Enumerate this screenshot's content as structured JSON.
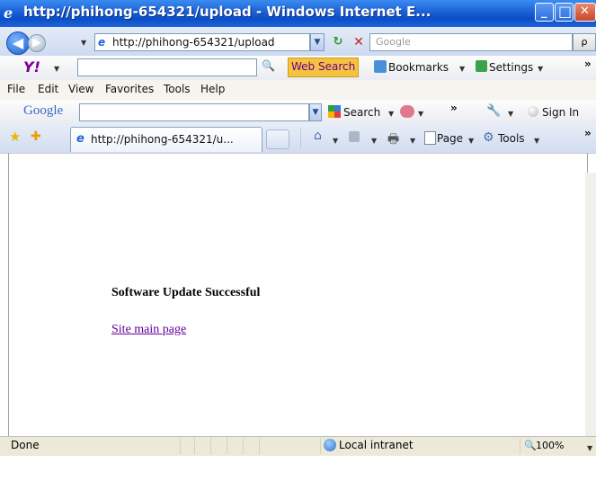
{
  "window": {
    "title": "http://phihong-654321/upload - Windows Internet E...",
    "min_glyph": "_",
    "max_glyph": "□",
    "close_glyph": "✕"
  },
  "nav": {
    "back_glyph": "◀",
    "forward_glyph": "▶",
    "address": "http://phihong-654321/upload",
    "search_placeholder": "Google",
    "search_glyph": "ρ"
  },
  "yahoo_toolbar": {
    "logo": "Y!",
    "web_search": "Web Search",
    "bookmarks": "Bookmarks",
    "settings": "Settings",
    "more": "»"
  },
  "menu": [
    "File",
    "Edit",
    "View",
    "Favorites",
    "Tools",
    "Help"
  ],
  "google_toolbar": {
    "logo": "Google",
    "search": "Search",
    "more": "»",
    "sign_in": "Sign In"
  },
  "tabs": {
    "active_tab": "http://phihong-654321/u...",
    "page_menu": "Page",
    "tools_menu": "Tools"
  },
  "content": {
    "heading": "Software Update Successful",
    "link": "Site main page"
  },
  "status": {
    "text": "Done",
    "zone": "Local intranet",
    "zoom": "100%"
  },
  "colors": {
    "titlebar": "#1b5fd6",
    "link_visited": "#660099"
  }
}
